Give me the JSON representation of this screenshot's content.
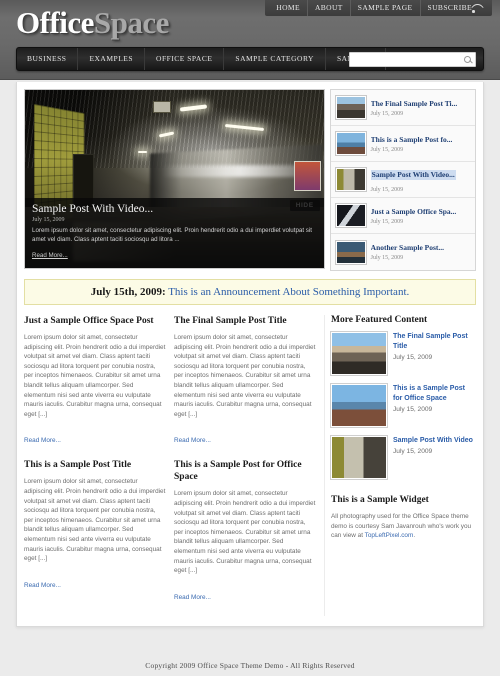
{
  "header": {
    "logo_primary": "Office",
    "logo_secondary": "Space",
    "topnav": [
      {
        "label": "HOME"
      },
      {
        "label": "ABOUT"
      },
      {
        "label": "SAMPLE PAGE"
      },
      {
        "label": "SUBSCRIBE"
      }
    ],
    "mainnav": [
      {
        "label": "BUSINESS"
      },
      {
        "label": "EXAMPLES"
      },
      {
        "label": "OFFICE SPACE"
      },
      {
        "label": "SAMPLE CATEGORY"
      },
      {
        "label": "SAMPLES"
      }
    ],
    "search": {
      "value": "",
      "placeholder": ""
    }
  },
  "feature": {
    "hide_label": "HIDE",
    "title": "Sample Post With Video...",
    "date": "July 15, 2009",
    "excerpt": "Lorem ipsum dolor sit amet, consectetur adipiscing elit. Proin hendrerit odio a dui imperdiet volutpat sit amet vel diam. Class aptent taciti sociosqu ad litora ...",
    "read_more": "Read More...",
    "items": [
      {
        "title": "The Final Sample Post Ti...",
        "date": "July 15, 2009",
        "thumb": "th-street",
        "active": false
      },
      {
        "title": "This is a Sample Post fo...",
        "date": "July 15, 2009",
        "thumb": "th-tower",
        "active": false
      },
      {
        "title": "Sample Post With Video...",
        "date": "July 15, 2009",
        "thumb": "th-subway",
        "active": true
      },
      {
        "title": "Just a Sample Office Spa...",
        "date": "July 15, 2009",
        "thumb": "th-abstract",
        "active": false
      },
      {
        "title": "Another Sample Post...",
        "date": "July 15, 2009",
        "thumb": "th-boat",
        "active": false
      }
    ]
  },
  "announcement": {
    "date": "July 15th, 2009:",
    "text": "This is an Announcement About Something Important."
  },
  "posts": [
    {
      "title": "Just a Sample Office Space Post",
      "body": "Lorem ipsum dolor sit amet, consectetur adipiscing elit. Proin hendrerit odio a dui imperdiet volutpat sit amet vel diam. Class aptent taciti sociosqu ad litora torquent per conubia nostra, per inceptos himenaeos. Curabitur sit amet urna blandit tellus aliquam ullamcorper. Sed elementum nisi sed ante viverra eu vulputate mauris iaculis. Curabitur magna urna, consequat eget [...]",
      "read_more": "Read More..."
    },
    {
      "title": "The Final Sample Post Title",
      "body": "Lorem ipsum dolor sit amet, consectetur adipiscing elit. Proin hendrerit odio a dui imperdiet volutpat sit amet vel diam. Class aptent taciti sociosqu ad litora torquent per conubia nostra, per inceptos himenaeos. Curabitur sit amet urna blandit tellus aliquam ullamcorper. Sed elementum nisi sed ante viverra eu vulputate mauris iaculis. Curabitur magna urna, consequat eget [...]",
      "read_more": "Read More..."
    },
    {
      "title": "This is a Sample Post Title",
      "body": "Lorem ipsum dolor sit amet, consectetur adipiscing elit. Proin hendrerit odio a dui imperdiet volutpat sit amet vel diam. Class aptent taciti sociosqu ad litora torquent per conubia nostra, per inceptos himenaeos. Curabitur sit amet urna blandit tellus aliquam ullamcorper. Sed elementum nisi sed ante viverra eu vulputate mauris iaculis. Curabitur magna urna, consequat eget [...]",
      "read_more": "Read More..."
    },
    {
      "title": "This is a Sample Post for Office Space",
      "body": "Lorem ipsum dolor sit amet, consectetur adipiscing elit. Proin hendrerit odio a dui imperdiet volutpat sit amet vel diam. Class aptent taciti sociosqu ad litora torquent per conubia nostra, per inceptos himenaeos. Curabitur sit amet urna blandit tellus aliquam ullamcorper. Sed elementum nisi sed ante viverra eu vulputate mauris iaculis. Curabitur magna urna, consequat eget [...]",
      "read_more": "Read More..."
    }
  ],
  "sidebar": {
    "heading": "More Featured Content",
    "items": [
      {
        "title": "The Final Sample Post Title",
        "date": "July 15, 2009",
        "thumb": "sbt-street"
      },
      {
        "title": "This is a Sample Post for Office Space",
        "date": "July 15, 2009",
        "thumb": "sbt-tower"
      },
      {
        "title": "Sample Post With Video",
        "date": "July 15, 2009",
        "thumb": "sbt-subway"
      }
    ],
    "widget": {
      "heading": "This is a Sample Widget",
      "text_before": "All photography used for the Office Space theme demo is courtesy Sam Javanrouh who's work you can view at ",
      "link": "TopLeftPixel.com",
      "text_after": "."
    }
  },
  "footer": {
    "copyright": "Copyright 2009 Office Space Theme Demo - All Rights Reserved"
  }
}
